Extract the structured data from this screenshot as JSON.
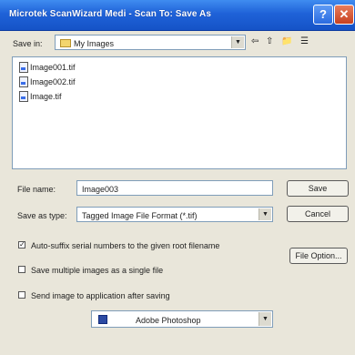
{
  "window": {
    "title": "Microtek ScanWizard Medi - Scan To: Save As",
    "help_glyph": "?",
    "close_glyph": "✕"
  },
  "save_in": {
    "label": "Save in:",
    "value": "My Images"
  },
  "files": [
    "Image001.tif",
    "Image002.tif",
    "Image.tif"
  ],
  "file_name": {
    "label": "File name:",
    "value": "Image003"
  },
  "save_as_type": {
    "label": "Save as type:",
    "value": "Tagged Image File Format (*.tif)"
  },
  "buttons": {
    "save": "Save",
    "cancel": "Cancel",
    "file_option": "File Option..."
  },
  "options": {
    "auto_suffix": {
      "label": "Auto-suffix serial numbers to the given root filename",
      "checked": true
    },
    "save_multiple": {
      "label": "Save multiple images as a single file",
      "checked": false
    },
    "send_image": {
      "label": "Send image to application after saving",
      "checked": false
    }
  },
  "application": {
    "value": "Adobe Photoshop"
  },
  "glyphs": {
    "check": "✓",
    "arrow_down": "▼",
    "back": "⇦",
    "up_folder": "⇧",
    "new_folder": "📁",
    "views": "☰"
  },
  "icons": {
    "folder": "folder-icon",
    "file": "tif-file-icon",
    "application": "photoshop-icon"
  },
  "colors": {
    "titlebar": "#1f62d8",
    "dialog_bg": "#e9e6da"
  }
}
